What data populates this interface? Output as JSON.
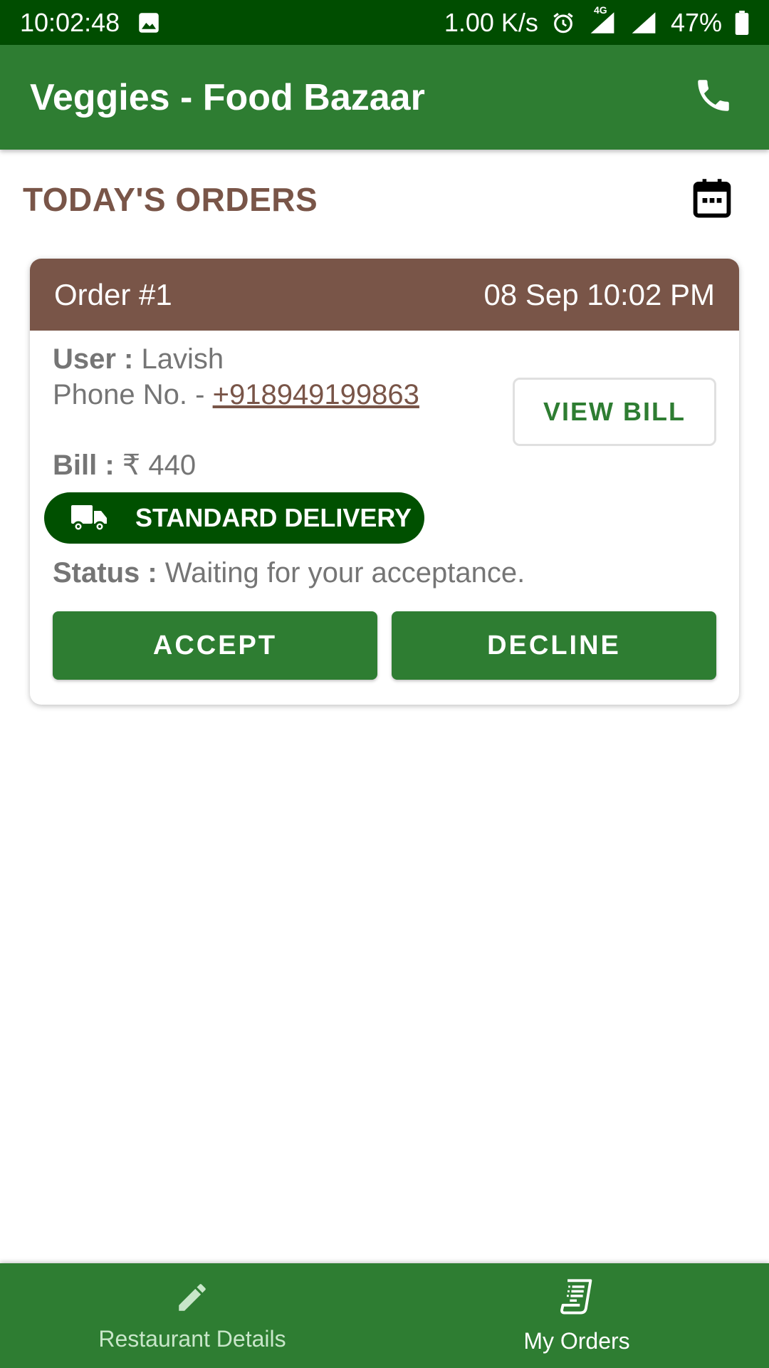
{
  "status_bar": {
    "time": "10:02:48",
    "network_speed": "1.00 K/s",
    "network_type": "4G",
    "battery": "47%",
    "icons": [
      "image-icon",
      "alarm-icon",
      "signal-4g-icon",
      "signal-icon",
      "battery-icon"
    ]
  },
  "app_bar": {
    "title": "Veggies - Food Bazaar",
    "icons": [
      "phone-icon"
    ]
  },
  "section": {
    "title": "TODAY'S ORDERS",
    "icons": [
      "calendar-icon"
    ]
  },
  "order": {
    "number": "Order #1",
    "datetime": "08 Sep 10:02 PM",
    "user_label": "User :",
    "user_name": "Lavish",
    "phone_label": "Phone No. -",
    "phone": "+918949199863",
    "bill_label": "Bill :",
    "bill_amount": "₹ 440",
    "view_bill": "VIEW BILL",
    "delivery_type": "STANDARD DELIVERY",
    "status_label": "Status :",
    "status_text": "Waiting for your acceptance.",
    "accept": "ACCEPT",
    "decline": "DECLINE"
  },
  "bottom_nav": {
    "items": [
      {
        "label": "Restaurant Details",
        "icon": "pencil-icon",
        "active": false
      },
      {
        "label": "My Orders",
        "icon": "receipt-icon",
        "active": true
      }
    ]
  },
  "colors": {
    "status_bar": "#004d00",
    "primary": "#2e7d32",
    "brown": "#795548",
    "pill": "#005000",
    "text_gray": "#757575"
  }
}
